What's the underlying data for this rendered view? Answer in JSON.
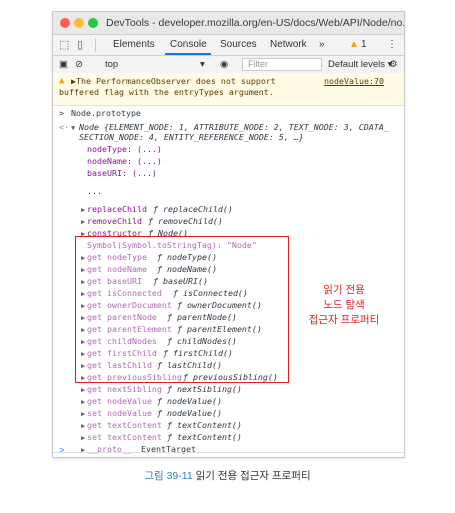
{
  "window": {
    "title": "DevTools - developer.mozilla.org/en-US/docs/Web/API/Node/no..."
  },
  "toolbar": {
    "tabs": [
      "Elements",
      "Console",
      "Sources",
      "Network",
      "»"
    ],
    "selected_tab": "Console",
    "warning_count": "1"
  },
  "filterbar": {
    "context": "top",
    "filter_placeholder": "Filter",
    "levels": "Default levels ▾"
  },
  "warning": {
    "line1": "▶The PerformanceObserver does not support",
    "line2": "buffered flag with the entryTypes argument.",
    "source": "nodeValue:70"
  },
  "console": {
    "input": "Node.prototype",
    "summary_line1": "Node {ELEMENT_NODE: 1, ATTRIBUTE_NODE: 2, TEXT_NODE: 3, CDATA_",
    "summary_line2": "SECTION_NODE: 4, ENTITY_REFERENCE_NODE: 5, …}",
    "fields": [
      "nodeType: (...)",
      "nodeName: (...)",
      "baseURI: (...)"
    ],
    "ellipsis": "...",
    "methods": [
      {
        "name": "replaceChild",
        "value": "ƒ replaceChild()"
      },
      {
        "name": "removeChild",
        "value": "ƒ removeChild()"
      },
      {
        "name": "constructor",
        "value": "ƒ Node()"
      }
    ],
    "symbol_line": "Symbol(Symbol.toStringTag): \"Node\"",
    "getters": [
      {
        "name": "get nodeType",
        "value": "ƒ nodeType()"
      },
      {
        "name": "get nodeName",
        "value": "ƒ nodeName()"
      },
      {
        "name": "get baseURI",
        "value": "ƒ baseURI()"
      },
      {
        "name": "get isConnected",
        "value": "ƒ isConnected()"
      },
      {
        "name": "get ownerDocument",
        "value": "ƒ ownerDocument()"
      },
      {
        "name": "get parentNode",
        "value": "ƒ parentNode()"
      },
      {
        "name": "get parentElement",
        "value": "ƒ parentElement()"
      },
      {
        "name": "get childNodes",
        "value": "ƒ childNodes()"
      },
      {
        "name": "get firstChild",
        "value": "ƒ firstChild()"
      },
      {
        "name": "get lastChild",
        "value": "ƒ lastChild()"
      },
      {
        "name": "get previousSibling",
        "value": "ƒ previousSibling()"
      },
      {
        "name": "get nextSibling",
        "value": "ƒ nextSibling()"
      }
    ],
    "accessors": [
      {
        "name": "get nodeValue",
        "value": "ƒ nodeValue()"
      },
      {
        "name": "set nodeValue",
        "value": "ƒ nodeValue()"
      },
      {
        "name": "get textContent",
        "value": "ƒ textContent()"
      },
      {
        "name": "set textContent",
        "value": "ƒ textContent()"
      },
      {
        "name": "__proto__",
        "value": "EventTarget"
      }
    ],
    "prompt": ">"
  },
  "annotation": {
    "line1": "읽기 전용",
    "line2": "노드 탐색",
    "line3": "접근자 프로퍼티"
  },
  "caption": {
    "figure": "그림 39-11",
    "text": "읽기 전용 접근자 프로퍼티"
  },
  "colors": {
    "highlight_red": "#e02020",
    "caption_blue": "#2a7fd4",
    "selected_tab_blue": "#1a73e8"
  }
}
